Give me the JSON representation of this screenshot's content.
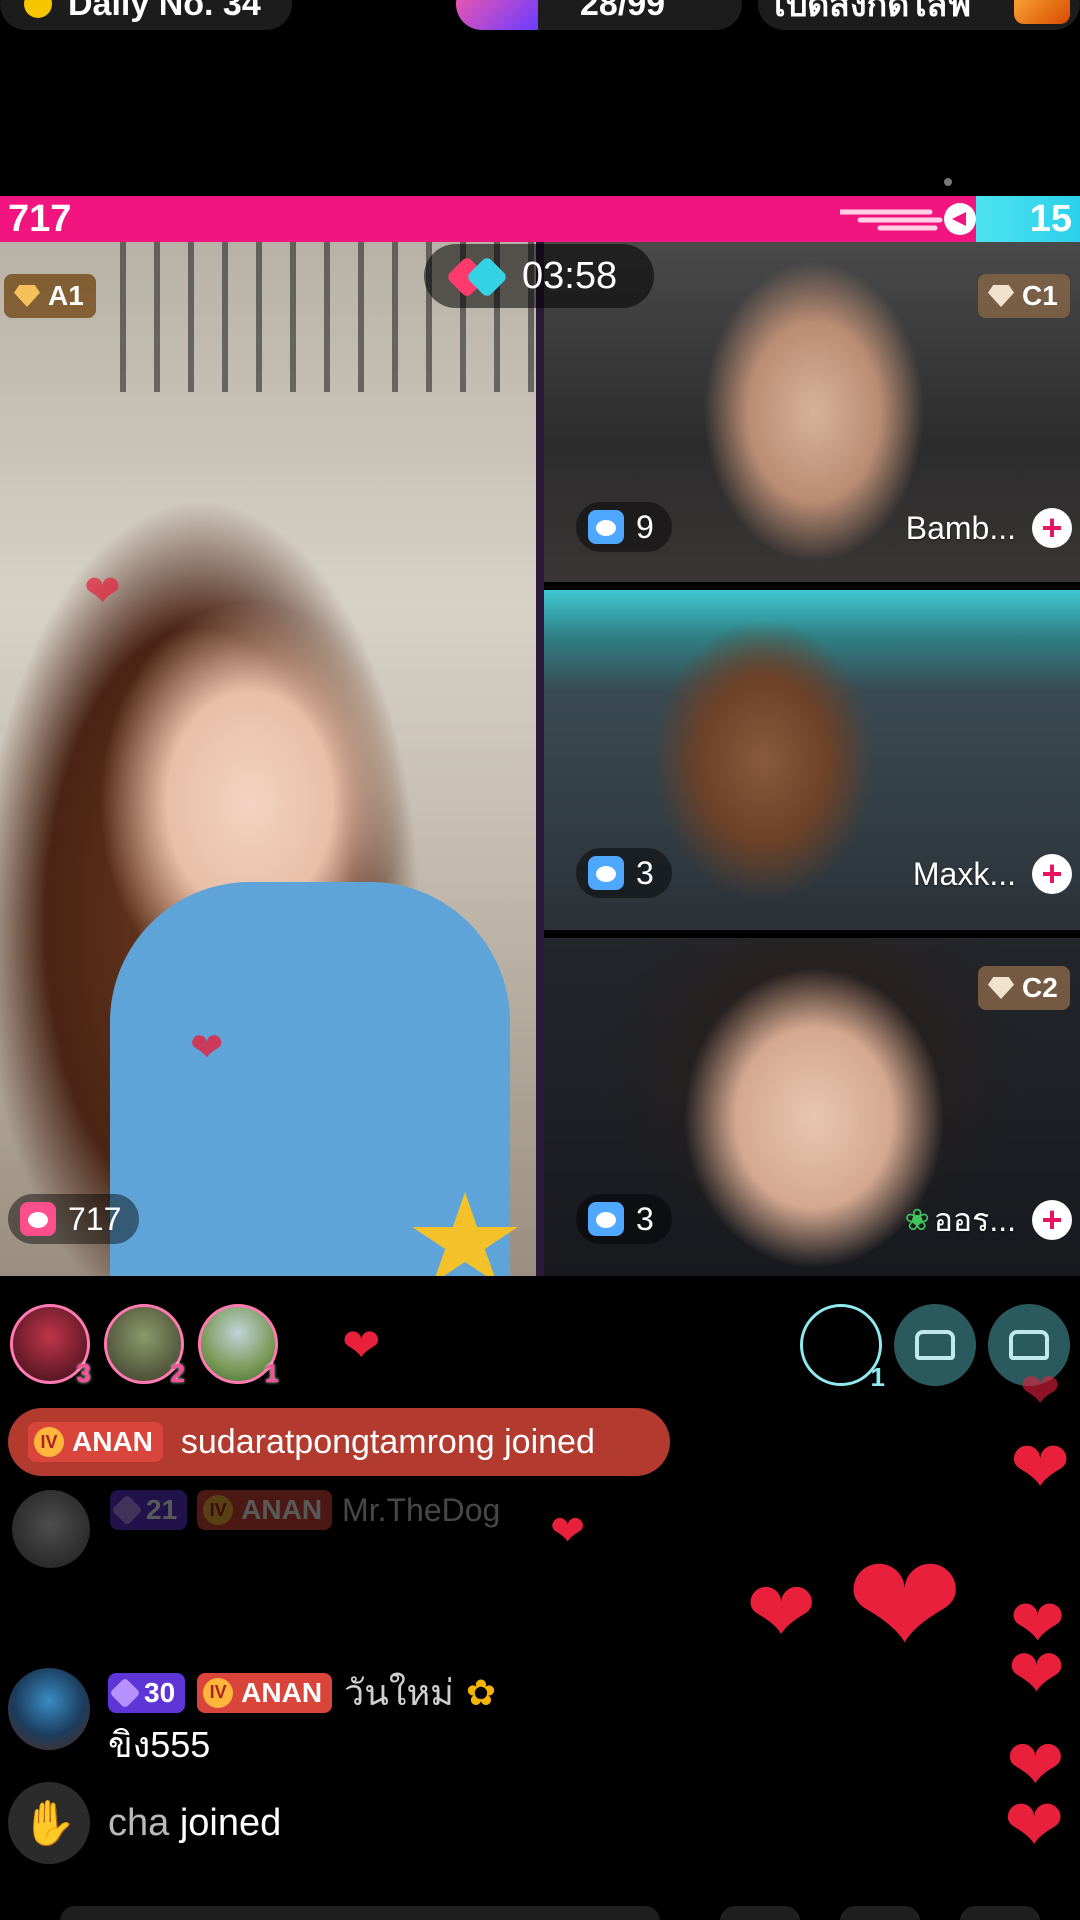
{
  "top": {
    "daily_label": "Daily No. 34",
    "rank_label": "28/99",
    "promo_label": "เปิดสิ่งกัดไลฟ์"
  },
  "battle": {
    "left_score": "717",
    "right_score": "15",
    "timer": "03:58"
  },
  "panels": {
    "main": {
      "tier": "A1",
      "gifts": "717"
    },
    "c1": {
      "tier": "C1",
      "gifts": "9",
      "name": "Bamb..."
    },
    "c2": {
      "gifts": "3",
      "name": "Maxk..."
    },
    "c3": {
      "tier": "C2",
      "gifts": "3",
      "name": "ออร..."
    }
  },
  "viewers": {
    "ranks": [
      "3",
      "2",
      "1"
    ],
    "ring_count": "1"
  },
  "join_banner": {
    "badge": "ANAN",
    "message": "sudaratpongtamrong joined"
  },
  "faded_chat": {
    "level": "21",
    "badge": "ANAN",
    "name": "Mr.TheDog"
  },
  "chat": {
    "level": "30",
    "badge": "ANAN",
    "name": "วันใหม่",
    "message": "ขิง555"
  },
  "system": {
    "user": "cha",
    "action": "joined"
  },
  "colors": {
    "left_team": "#f2157f",
    "right_team": "#2bd0ea",
    "heart": "#e8203c"
  }
}
